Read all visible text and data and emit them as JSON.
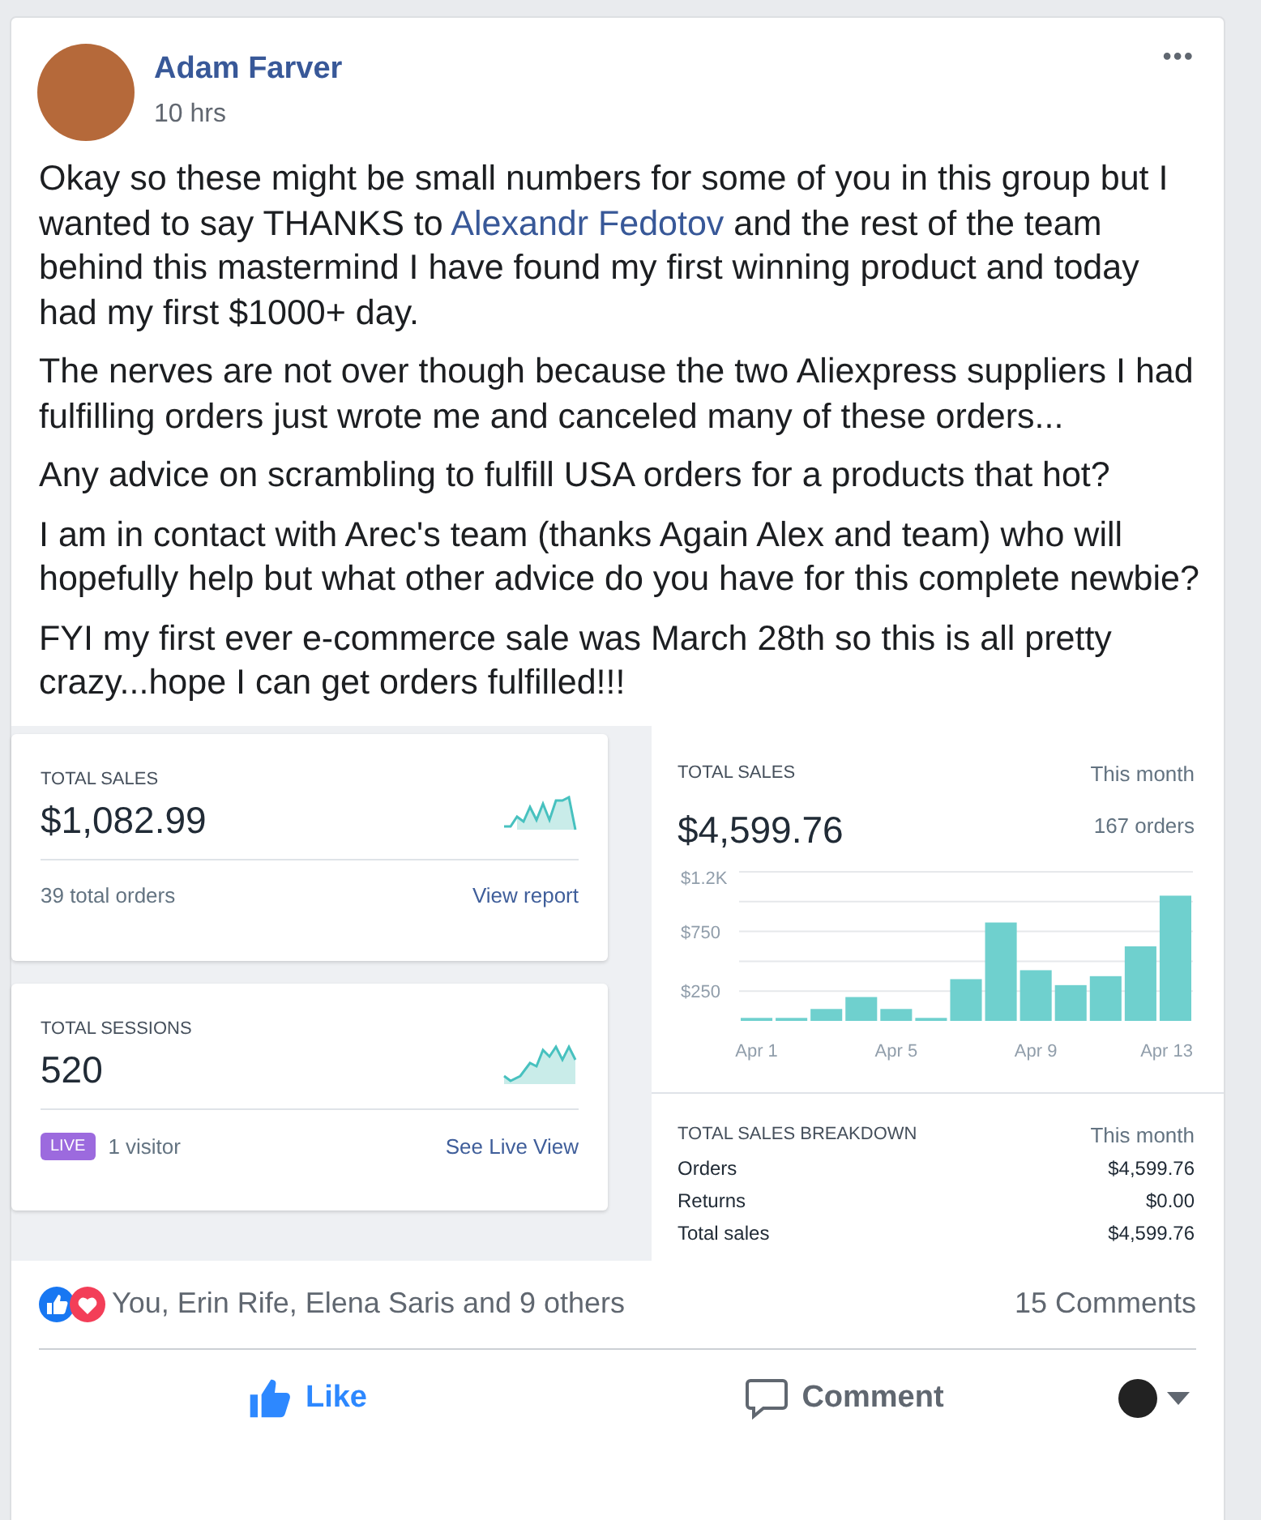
{
  "post": {
    "author": "Adam Farver",
    "time": "10 hrs",
    "more": "•••",
    "paragraphs": [
      [
        {
          "kind": "text",
          "text": "Okay so these might be small numbers for some of you in this group but I wanted to say THANKS to "
        },
        {
          "kind": "link",
          "text": "Alexandr Fedotov"
        },
        {
          "kind": "text",
          "text": " and the rest of the team behind this mastermind I have found my first winning product and today had my first $1000+ day."
        }
      ],
      [
        {
          "kind": "text",
          "text": "The nerves are not over though because the two Aliexpress suppliers I had fulfilling orders just wrote me and canceled many of these orders..."
        }
      ],
      [
        {
          "kind": "text",
          "text": "Any advice on scrambling to fulfill USA orders for a products that hot?"
        }
      ],
      [
        {
          "kind": "text",
          "text": "I am in contact with Arec's team (thanks Again Alex and team) who will hopefully help but what other advice do you have for this complete newbie?"
        }
      ],
      [
        {
          "kind": "text",
          "text": "FYI my first ever e-commerce sale was March 28th so this is all pretty crazy...hope I can get orders fulfilled!!!"
        }
      ]
    ]
  },
  "dashboard": {
    "sales_card": {
      "title": "TOTAL SALES",
      "value": "$1,082.99",
      "footer": "39 total orders",
      "link": "View report"
    },
    "sessions_card": {
      "title": "TOTAL SESSIONS",
      "value": "520",
      "badge": "LIVE",
      "footer": "1 visitor",
      "link": "See Live View"
    },
    "sales_chart": {
      "title": "TOTAL SALES",
      "period": "This month",
      "value": "$4,599.76",
      "orders": "167 orders",
      "chart_data": {
        "type": "bar",
        "categories": [
          "Apr 1",
          null,
          null,
          null,
          "Apr 5",
          null,
          null,
          null,
          "Apr 9",
          null,
          null,
          null,
          "Apr 13"
        ],
        "values": [
          25,
          25,
          100,
          200,
          100,
          25,
          350,
          825,
          425,
          300,
          375,
          625,
          1050
        ],
        "color": "#6fd0ce",
        "ylim": [
          0,
          1250
        ],
        "yticks": [
          {
            "value": 250,
            "label": "$250"
          },
          {
            "value": 750,
            "label": "$750"
          },
          {
            "value": 1200,
            "label": "$1.2K"
          }
        ]
      }
    },
    "breakdown": {
      "title": "TOTAL SALES BREAKDOWN",
      "period": "This month",
      "rows": [
        {
          "label": "Orders",
          "value": "$4,599.76"
        },
        {
          "label": "Returns",
          "value": "$0.00"
        },
        {
          "label": "Total sales",
          "value": "$4,599.76"
        }
      ]
    }
  },
  "reactions": {
    "text": "You, Erin Rife, Elena Saris and 9 others",
    "comments": "15 Comments"
  },
  "actions": [
    {
      "kind": "like",
      "label": "Like",
      "selected": true
    },
    {
      "kind": "comment",
      "label": "Comment",
      "selected": false
    }
  ]
}
